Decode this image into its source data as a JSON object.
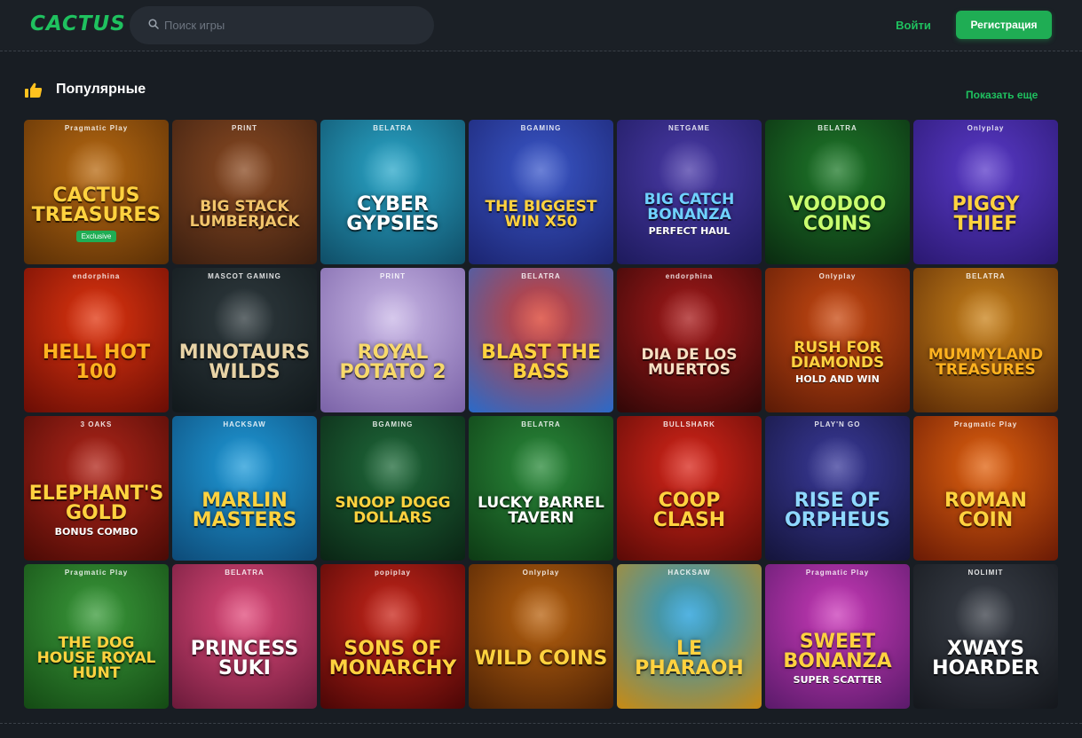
{
  "header": {
    "logo": "CACTUS",
    "search_placeholder": "Поиск игры",
    "login_label": "Войти",
    "register_label": "Регистрация"
  },
  "section": {
    "title": "Популярные",
    "show_more_label": "Показать еще"
  },
  "games": [
    {
      "title": "Cactus Treasures",
      "provider": "Pragmatic Play",
      "badge": "Exclusive",
      "bg": "#b86a12",
      "bg2": "#5a2f06",
      "title_color": "#ffd23f"
    },
    {
      "title": "Big Stack Lumberjack",
      "provider": "PRINT",
      "bg": "#8a4a22",
      "bg2": "#3a1e10",
      "title_color": "#f1c46b"
    },
    {
      "title": "Cyber Gypsies",
      "provider": "BELATRA",
      "bg": "#2aa7c9",
      "bg2": "#0f4d66",
      "title_color": "#ffffff"
    },
    {
      "title": "The Biggest Win x50",
      "provider": "BGAMING",
      "bg": "#3a57c9",
      "bg2": "#1b2470",
      "title_color": "#ffd23f"
    },
    {
      "title": "Big Catch Bonanza",
      "subtitle": "Perfect Haul",
      "provider": "NETGAME",
      "bg": "#4a3aa7",
      "bg2": "#1d1a5c",
      "title_color": "#6fd1ff"
    },
    {
      "title": "Voodoo Coins",
      "provider": "BELATRA",
      "bg": "#1f7a2a",
      "bg2": "#0a2a10",
      "title_color": "#c9ff6f"
    },
    {
      "title": "Piggy Thief",
      "provider": "Onlyplay",
      "bg": "#5a3ac9",
      "bg2": "#2a1870",
      "title_color": "#ffd23f"
    },
    {
      "title": "Hell Hot 100",
      "provider": "endorphina",
      "bg": "#e0350f",
      "bg2": "#6a0d05",
      "title_color": "#ffb21f"
    },
    {
      "title": "Minotaurs Wilds",
      "provider": "MASCOT GAMING",
      "bg": "#2f3a3e",
      "bg2": "#11181b",
      "title_color": "#e8d3a6"
    },
    {
      "title": "Royal Potato 2",
      "provider": "PRINT",
      "bg": "#c9b7e6",
      "bg2": "#7a62a7",
      "title_color": "#f7d96b"
    },
    {
      "title": "Blast the Bass",
      "provider": "BELATRA",
      "bg": "#d83a2a",
      "bg2": "#2a6ac9",
      "title_color": "#ffd23f"
    },
    {
      "title": "Dia de los Muertos",
      "provider": "endorphina",
      "bg": "#a71a1a",
      "bg2": "#300707",
      "title_color": "#f7e0c4"
    },
    {
      "title": "Rush for Diamonds",
      "subtitle": "Hold and Win",
      "provider": "Onlyplay",
      "bg": "#c94a12",
      "bg2": "#5a1a06",
      "title_color": "#ffd23f"
    },
    {
      "title": "Mummyland Treasures",
      "provider": "BELATRA",
      "bg": "#c9821a",
      "bg2": "#5a2a06",
      "title_color": "#ffb21f"
    },
    {
      "title": "Elephant's Gold",
      "subtitle": "Bonus Combo",
      "provider": "3 OAKS",
      "bg": "#b1261a",
      "bg2": "#4a0a05",
      "title_color": "#ffd23f"
    },
    {
      "title": "Marlin Masters",
      "provider": "HACKSAW",
      "bg": "#1f9ad8",
      "bg2": "#0d4a77",
      "title_color": "#ffd23f"
    },
    {
      "title": "Snoop Dogg Dollars",
      "provider": "BGAMING",
      "bg": "#1f6a3a",
      "bg2": "#0a2414",
      "title_color": "#ffd23f"
    },
    {
      "title": "Lucky Barrel Tavern",
      "provider": "BELATRA",
      "bg": "#2a8a3a",
      "bg2": "#0d3a14",
      "title_color": "#ffffff"
    },
    {
      "title": "Coop Clash",
      "provider": "BULLSHARK",
      "bg": "#d8261a",
      "bg2": "#5a0a06",
      "title_color": "#ffd23f"
    },
    {
      "title": "Rise of Orpheus",
      "provider": "PLAY'N GO",
      "bg": "#3a3a9a",
      "bg2": "#14143a",
      "title_color": "#8fd8ff"
    },
    {
      "title": "Roman Coin",
      "provider": "Pragmatic Play",
      "bg": "#e0620f",
      "bg2": "#6a1a05",
      "title_color": "#ffd23f"
    },
    {
      "title": "The Dog House Royal Hunt",
      "provider": "Pragmatic Play",
      "bg": "#3a9a3a",
      "bg2": "#144a14",
      "title_color": "#ffd23f"
    },
    {
      "title": "Princess Suki",
      "provider": "BELATRA",
      "bg": "#e04a7a",
      "bg2": "#6a1a3a",
      "title_color": "#ffffff"
    },
    {
      "title": "Sons of Monarchy",
      "provider": "popiplay",
      "bg": "#c9261a",
      "bg2": "#4a0606",
      "title_color": "#ffd23f"
    },
    {
      "title": "Wild Coins",
      "provider": "Onlyplay",
      "bg": "#b8620f",
      "bg2": "#4a2005",
      "title_color": "#ffd23f"
    },
    {
      "title": "Le Pharaoh",
      "provider": "HACKSAW",
      "bg": "#1a9ad8",
      "bg2": "#c98a12",
      "title_color": "#ffd23f"
    },
    {
      "title": "Sweet Bonanza",
      "subtitle": "Super Scatter",
      "provider": "Pragmatic Play",
      "bg": "#c93ab8",
      "bg2": "#5a1a6a",
      "title_color": "#ffd23f"
    },
    {
      "title": "xWays Hoarder",
      "provider": "NOLIMIT",
      "bg": "#3a3f48",
      "bg2": "#14171c",
      "title_color": "#ffffff"
    }
  ]
}
